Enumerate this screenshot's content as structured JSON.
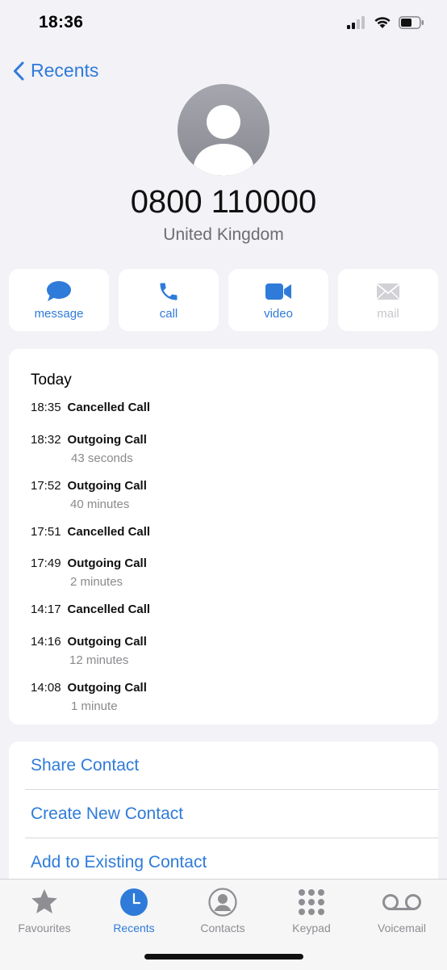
{
  "status_bar": {
    "time": "18:36",
    "icons": [
      "cellular-signal-icon",
      "wifi-icon",
      "battery-icon"
    ]
  },
  "nav": {
    "back_label": "Recents"
  },
  "contact": {
    "number": "0800 110000",
    "country": "United Kingdom"
  },
  "actions": [
    {
      "label": "message",
      "icon": "message-icon",
      "enabled": true
    },
    {
      "label": "call",
      "icon": "phone-icon",
      "enabled": true
    },
    {
      "label": "video",
      "icon": "video-icon",
      "enabled": true
    },
    {
      "label": "mail",
      "icon": "mail-icon",
      "enabled": false
    }
  ],
  "calls": {
    "header": "Today",
    "items": [
      {
        "time": "18:35",
        "type": "Cancelled Call",
        "duration": ""
      },
      {
        "time": "18:32",
        "type": "Outgoing Call",
        "duration": "43 seconds"
      },
      {
        "time": "17:52",
        "type": "Outgoing Call",
        "duration": "40 minutes"
      },
      {
        "time": "17:51",
        "type": "Cancelled Call",
        "duration": ""
      },
      {
        "time": "17:49",
        "type": "Outgoing Call",
        "duration": "2 minutes"
      },
      {
        "time": "14:17",
        "type": "Cancelled Call",
        "duration": ""
      },
      {
        "time": "14:16",
        "type": "Outgoing Call",
        "duration": "12 minutes"
      },
      {
        "time": "14:08",
        "type": "Outgoing Call",
        "duration": "1 minute"
      }
    ]
  },
  "links": [
    {
      "label": "Share Contact"
    },
    {
      "label": "Create New Contact"
    },
    {
      "label": "Add to Existing Contact"
    }
  ],
  "tabs": [
    {
      "label": "Favourites",
      "icon": "star-icon",
      "active": false
    },
    {
      "label": "Recents",
      "icon": "clock-icon",
      "active": true
    },
    {
      "label": "Contacts",
      "icon": "person-circle-icon",
      "active": false
    },
    {
      "label": "Keypad",
      "icon": "keypad-icon",
      "active": false
    },
    {
      "label": "Voicemail",
      "icon": "voicemail-icon",
      "active": false
    }
  ],
  "colors": {
    "accent": "#2f7bd9",
    "background": "#f2f2f7",
    "card": "#ffffff",
    "secondary_text": "#8a8a8e",
    "disabled": "#c7c7cc"
  }
}
